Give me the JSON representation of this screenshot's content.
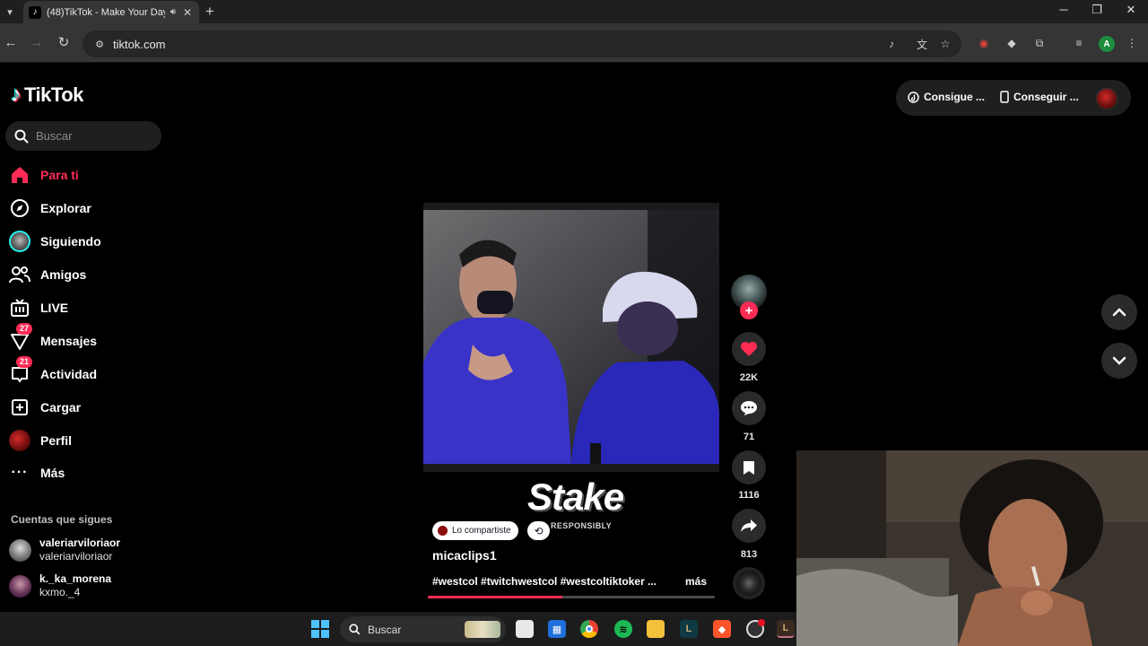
{
  "browser": {
    "tab_title": "(48)TikTok - Make Your Day",
    "url": "tiktok.com",
    "profile_initial": "A",
    "window_controls": {
      "minimize": "─",
      "restore": "❐",
      "close": "✕"
    }
  },
  "sidebar": {
    "logo_text": "TikTok",
    "search_placeholder": "Buscar",
    "nav": [
      {
        "label": "Para ti",
        "icon": "home-icon",
        "active": true
      },
      {
        "label": "Explorar",
        "icon": "compass-icon"
      },
      {
        "label": "Siguiendo",
        "icon": "following-avatar-icon"
      },
      {
        "label": "Amigos",
        "icon": "friends-icon"
      },
      {
        "label": "LIVE",
        "icon": "live-tv-icon"
      },
      {
        "label": "Mensajes",
        "icon": "messages-icon",
        "badge": "27"
      },
      {
        "label": "Actividad",
        "icon": "activity-icon",
        "badge": "21"
      },
      {
        "label": "Cargar",
        "icon": "upload-icon"
      },
      {
        "label": "Perfil",
        "icon": "profile-avatar-icon"
      },
      {
        "label": "Más",
        "icon": "more-dots-icon"
      }
    ],
    "following_title": "Cuentas que sigues",
    "following": [
      {
        "name": "valeriarviloriaor",
        "handle": "valeriarviloriaor"
      },
      {
        "name": "k._ka_morena",
        "handle": "kxmo._4"
      }
    ]
  },
  "top_right": {
    "get_coins_label": "Consigue ...",
    "get_app_label": "Conseguir ..."
  },
  "video": {
    "overlay_brand": "Stake",
    "overlay_brand_sub": "RESPONSIBLY",
    "shared_label": "Lo compartiste",
    "author": "micaclips1",
    "hashtags": "#westcol #twitchwestcol #westcoltiktoker ...",
    "more_label": "más",
    "progress_fraction": 0.47
  },
  "actions": {
    "likes": "22K",
    "comments": "71",
    "saves": "1116",
    "shares": "813"
  },
  "taskbar": {
    "search_label": "Buscar"
  },
  "colors": {
    "accent": "#fe2c55",
    "background": "#000000",
    "chrome": "#353535"
  }
}
